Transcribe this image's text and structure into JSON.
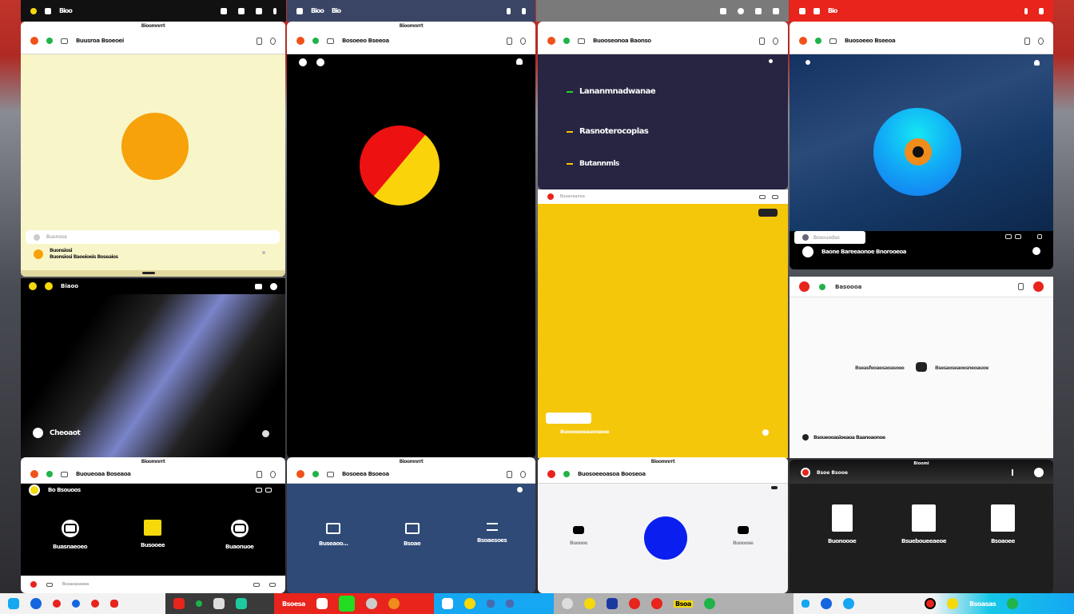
{
  "topbars": [
    {
      "label": "Bioo",
      "bg": "#111111"
    },
    {
      "label": "Bioo",
      "label2": "Bio",
      "bg": "#3a4566"
    },
    {
      "bg": "#7a7a7a"
    },
    {
      "label": "Bio",
      "bg": "#e8241c"
    }
  ],
  "panel1": {
    "caption": "Bioomnrrt",
    "title": "Buusroa Bsoeoei",
    "circle_color": "#f7a10b",
    "bg": "#f8f6c8",
    "search_placeholder": "Buonoos",
    "item_text": "Buonsiosi Baoeioeis Boseaios",
    "item_text2": "Buonsiosi"
  },
  "panel2": {
    "caption": "Bioomnrrt",
    "title": "Bosoeeo Bseeoa"
  },
  "panel3": {
    "title": "Buooseonoa Baonso",
    "items": [
      {
        "label": "Lananmnadwanae",
        "color": "#2ed12e"
      },
      {
        "label": "Rasnoterocoplas",
        "color": "#f5c70b"
      },
      {
        "label": "Butannmls",
        "color": "#f5c70b"
      }
    ],
    "yellow_header": "Boseneanoa",
    "yellow_caption": "Buoooesoeauonasoe"
  },
  "panel4": {
    "title": "Buosoeeo Bseeoa",
    "search_placeholder": "Bosouodso",
    "item_text": "Baone Bareeaonoe Bnorooeoa"
  },
  "panel5": {
    "title": "Biaoo",
    "caption": "Cheoaot"
  },
  "panel6": {
    "title": "Basoooa",
    "left_text": "Bseasfeoaesaoasoee",
    "right_text": "Bsesaoseaoesneoauoe",
    "footer_text": "Bsoueooasioeaoa Baanoaonoe"
  },
  "panel7": {
    "caption": "Bioomnrrt",
    "title": "Buoueoaa Boseaoa",
    "sub": "Bo Bsouoos",
    "tiles": [
      "Buasnaeoeo",
      "Busooee",
      "Buaonuoe"
    ],
    "footer": "Bsoaoasaoea"
  },
  "panel8": {
    "caption": "Bioomnrrt",
    "title": "Bosoeea Bsoeoa",
    "tiles": [
      "Buseaoo...",
      "Bsoae",
      "Bsoaesoes"
    ]
  },
  "panel9": {
    "caption": "Bioomnrrt",
    "title": "Buosoeeoasoa Booseoa",
    "tiles": [
      "Buooos",
      "Buooose"
    ]
  },
  "panel10": {
    "caption": "Bioomi",
    "title": "Bsoe Bsooe",
    "tiles": [
      "Buonoooe",
      "Bsueboueeaeoe",
      "Bsoaoee"
    ]
  },
  "dock": {
    "labels": [
      "Bsoesa",
      "Bsoa",
      "Bsoasas"
    ]
  }
}
